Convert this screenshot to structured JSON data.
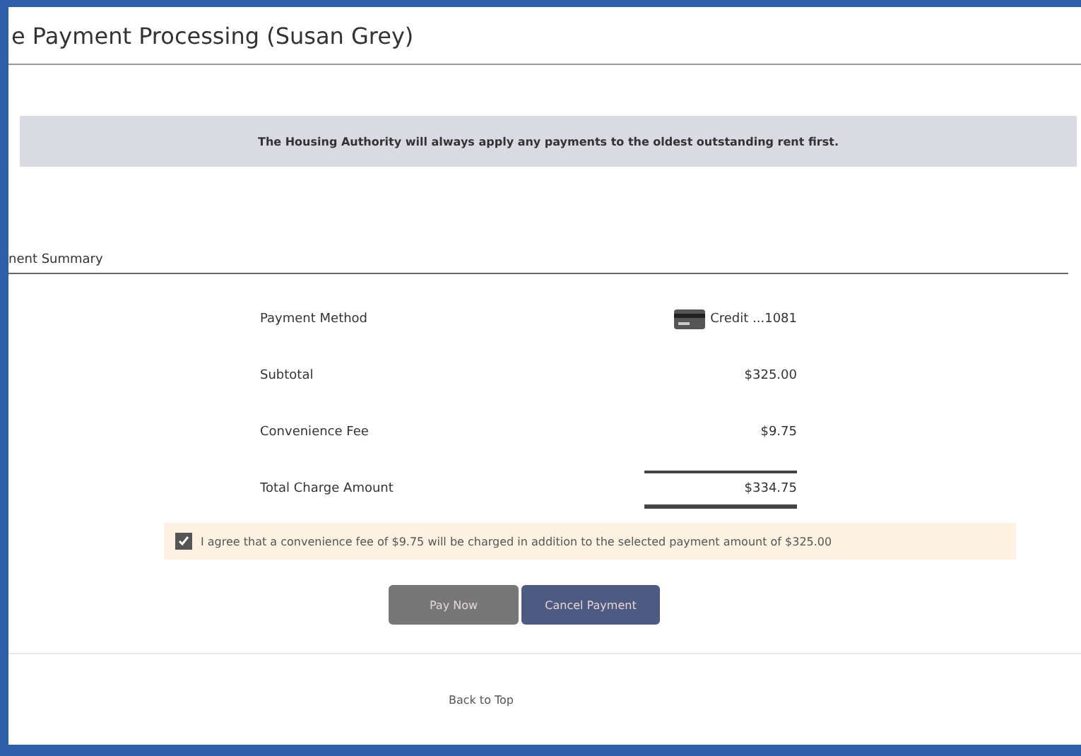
{
  "title": "e Payment Processing (Susan Grey)",
  "notice": "The Housing Authority will always apply any payments to the oldest outstanding rent first.",
  "section_title": "nent Summary",
  "summary": [
    {
      "kind": "card",
      "label": "Payment Method",
      "value": "Credit ...1081"
    },
    {
      "kind": "plain",
      "label": "Subtotal",
      "value": "$325.00"
    },
    {
      "kind": "plain",
      "label": "Convenience Fee",
      "value": "$9.75"
    },
    {
      "kind": "total",
      "label": "Total Charge Amount",
      "value": "$334.75"
    }
  ],
  "agreement": {
    "checked": true,
    "text": "I agree that a convenience fee of $9.75 will be charged in addition to the selected payment amount of $325.00"
  },
  "buttons": [
    {
      "kind": "primary",
      "label": "Pay Now"
    },
    {
      "kind": "secondary",
      "label": "Cancel Payment"
    }
  ],
  "back_link": "Back to Top"
}
